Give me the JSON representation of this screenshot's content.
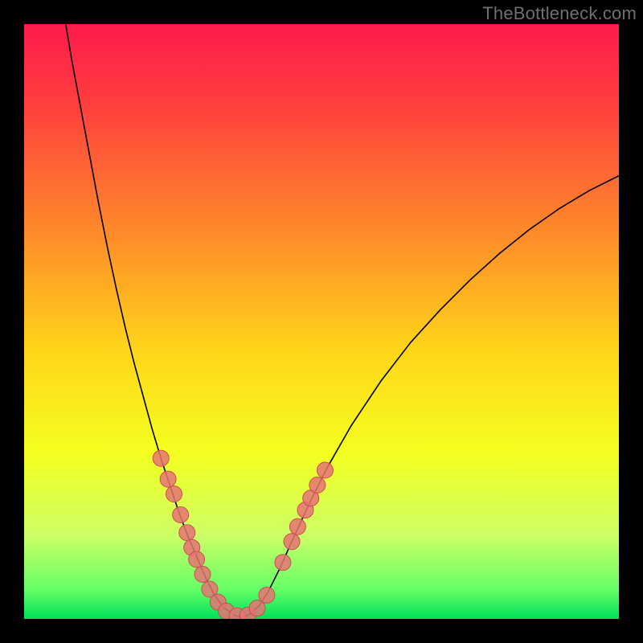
{
  "watermark": "TheBottleneck.com",
  "chart_data": {
    "type": "line",
    "title": "",
    "xlabel": "",
    "ylabel": "",
    "xlim": [
      0,
      100
    ],
    "ylim": [
      0,
      100
    ],
    "grid": false,
    "legend": false,
    "background_gradient_stops": [
      {
        "offset": 0.0,
        "color": "#ff1a4d"
      },
      {
        "offset": 0.12,
        "color": "#ff3a3f"
      },
      {
        "offset": 0.35,
        "color": "#ff8a2a"
      },
      {
        "offset": 0.55,
        "color": "#ffd619"
      },
      {
        "offset": 0.72,
        "color": "#f4ff1f"
      },
      {
        "offset": 0.86,
        "color": "#ccff66"
      },
      {
        "offset": 0.95,
        "color": "#66ff66"
      },
      {
        "offset": 1.0,
        "color": "#00e05a"
      }
    ],
    "series": [
      {
        "name": "left-branch",
        "stroke": "#000000",
        "stroke_width": 1.6,
        "points": [
          {
            "x": 7.0,
            "y": 100.0
          },
          {
            "x": 8.0,
            "y": 94.0
          },
          {
            "x": 9.5,
            "y": 86.0
          },
          {
            "x": 11.0,
            "y": 78.0
          },
          {
            "x": 12.5,
            "y": 70.0
          },
          {
            "x": 14.0,
            "y": 62.5
          },
          {
            "x": 15.5,
            "y": 55.5
          },
          {
            "x": 17.0,
            "y": 49.0
          },
          {
            "x": 18.5,
            "y": 43.0
          },
          {
            "x": 20.0,
            "y": 37.5
          },
          {
            "x": 21.5,
            "y": 32.0
          },
          {
            "x": 23.0,
            "y": 27.0
          },
          {
            "x": 24.5,
            "y": 22.5
          },
          {
            "x": 26.0,
            "y": 18.0
          },
          {
            "x": 27.5,
            "y": 14.0
          },
          {
            "x": 29.0,
            "y": 10.5
          },
          {
            "x": 30.5,
            "y": 7.0
          },
          {
            "x": 32.0,
            "y": 4.0
          },
          {
            "x": 33.5,
            "y": 2.0
          },
          {
            "x": 35.0,
            "y": 0.8
          },
          {
            "x": 36.5,
            "y": 0.2
          }
        ]
      },
      {
        "name": "right-branch",
        "stroke": "#000000",
        "stroke_width": 1.6,
        "points": [
          {
            "x": 36.5,
            "y": 0.2
          },
          {
            "x": 38.0,
            "y": 0.8
          },
          {
            "x": 39.5,
            "y": 2.2
          },
          {
            "x": 41.0,
            "y": 4.5
          },
          {
            "x": 43.0,
            "y": 8.5
          },
          {
            "x": 45.0,
            "y": 13.0
          },
          {
            "x": 48.0,
            "y": 19.5
          },
          {
            "x": 51.0,
            "y": 25.5
          },
          {
            "x": 55.0,
            "y": 32.5
          },
          {
            "x": 60.0,
            "y": 40.0
          },
          {
            "x": 65.0,
            "y": 46.5
          },
          {
            "x": 70.0,
            "y": 52.0
          },
          {
            "x": 75.0,
            "y": 57.0
          },
          {
            "x": 80.0,
            "y": 61.5
          },
          {
            "x": 85.0,
            "y": 65.5
          },
          {
            "x": 90.0,
            "y": 69.0
          },
          {
            "x": 95.0,
            "y": 72.0
          },
          {
            "x": 100.0,
            "y": 74.5
          }
        ]
      }
    ],
    "scatter": {
      "name": "highlighted-points",
      "fill": "#e57373",
      "stroke": "#c94f4f",
      "radius": 10,
      "points": [
        {
          "x": 23.0,
          "y": 27.0
        },
        {
          "x": 24.2,
          "y": 23.5
        },
        {
          "x": 25.2,
          "y": 21.0
        },
        {
          "x": 26.3,
          "y": 17.5
        },
        {
          "x": 27.4,
          "y": 14.5
        },
        {
          "x": 28.2,
          "y": 12.0
        },
        {
          "x": 29.0,
          "y": 10.0
        },
        {
          "x": 30.0,
          "y": 7.5
        },
        {
          "x": 31.2,
          "y": 5.0
        },
        {
          "x": 32.6,
          "y": 2.8
        },
        {
          "x": 34.0,
          "y": 1.3
        },
        {
          "x": 35.8,
          "y": 0.5
        },
        {
          "x": 37.6,
          "y": 0.6
        },
        {
          "x": 39.2,
          "y": 1.8
        },
        {
          "x": 40.8,
          "y": 4.0
        },
        {
          "x": 43.5,
          "y": 9.5
        },
        {
          "x": 45.0,
          "y": 13.0
        },
        {
          "x": 46.0,
          "y": 15.5
        },
        {
          "x": 47.3,
          "y": 18.3
        },
        {
          "x": 48.2,
          "y": 20.3
        },
        {
          "x": 49.3,
          "y": 22.5
        },
        {
          "x": 50.6,
          "y": 25.0
        }
      ]
    }
  }
}
